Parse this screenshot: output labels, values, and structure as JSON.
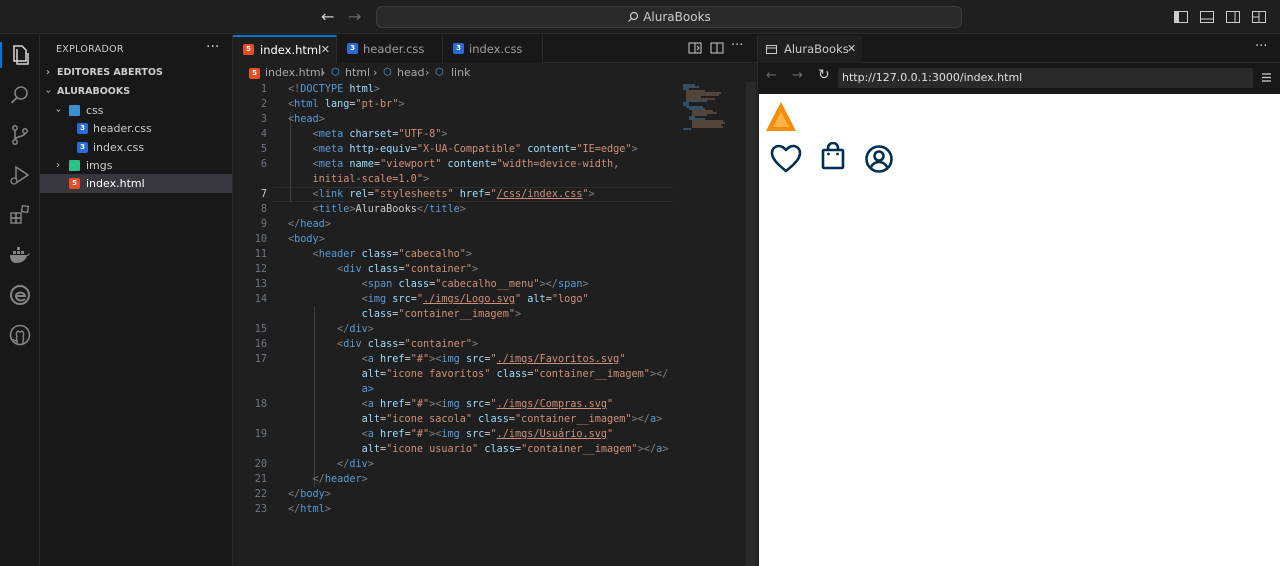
{
  "titlebar": {
    "back_icon": "arrow-left-icon",
    "forward_icon": "arrow-right-icon",
    "search_text": "AluraBooks"
  },
  "activity_bar": [
    "explorer-icon",
    "search-icon",
    "source-control-icon",
    "run-debug-icon",
    "extensions-icon",
    "docker-icon",
    "edge-icon",
    "github-icon"
  ],
  "sidebar": {
    "title": "EXPLORADOR",
    "more": "···",
    "sections": {
      "open_editors": "EDITORES ABERTOS",
      "project": "ALURABOOKS"
    },
    "tree": {
      "css_folder": "css",
      "header_css": "header.css",
      "index_css": "index.css",
      "imgs_folder": "imgs",
      "index_html": "index.html"
    }
  },
  "editor": {
    "tabs": {
      "t1": "index.html",
      "t2": "header.css",
      "t3": "index.css"
    },
    "close": "✕",
    "breadcrumb": {
      "file": "index.html",
      "c1": "html",
      "c2": "head",
      "c3": "link"
    },
    "lines": [
      {
        "n": "1"
      },
      {
        "n": "2"
      },
      {
        "n": "3"
      },
      {
        "n": "4"
      },
      {
        "n": "5"
      },
      {
        "n": "6"
      },
      {
        "n": "7"
      },
      {
        "n": "8"
      },
      {
        "n": "9"
      },
      {
        "n": "10"
      },
      {
        "n": "11"
      },
      {
        "n": "12"
      },
      {
        "n": "13"
      },
      {
        "n": "14"
      },
      {
        "n": "15"
      },
      {
        "n": "16"
      },
      {
        "n": "17"
      },
      {
        "n": "18"
      },
      {
        "n": "19"
      },
      {
        "n": "20"
      },
      {
        "n": "21"
      },
      {
        "n": "22"
      },
      {
        "n": "23"
      }
    ],
    "code": {
      "doctype": "DOCTYPE",
      "html": "html",
      "lang": "lang",
      "pt_br": "\"pt-br\"",
      "head": "head",
      "meta": "meta",
      "charset": "charset",
      "utf8": "\"UTF-8\"",
      "http_equiv": "http-equiv",
      "x_ua": "\"X-UA-Compatible\"",
      "content": "content",
      "ie_edge": "\"IE=edge\"",
      "name": "name",
      "viewport": "\"viewport\"",
      "vp_content1": "\"width=device-width,",
      "vp_content2": "initial-scale=1.0\"",
      "link": "link",
      "rel": "rel",
      "stylesheets": "\"stylesheets\"",
      "href": "href",
      "css_path": "/css/index.css",
      "title": "title",
      "title_text": "AluraBooks",
      "body": "body",
      "header": "header",
      "class": "class",
      "cabecalho": "\"cabecalho\"",
      "div": "div",
      "container": "\"container\"",
      "span": "span",
      "cabecalho_menu": "\"cabecalho__menu\"",
      "img": "img",
      "src": "src",
      "logo_path": "./imgs/Logo.svg",
      "alt": "alt",
      "logo_alt": "\"logo\"",
      "container_imagem": "\"container__imagem\"",
      "a": "a",
      "hash": "\"#\"",
      "fav_path": "./imgs/Favoritos.svg",
      "fav_alt": "\"icone favoritos\"",
      "comp_path": "./imgs/Compras.svg",
      "comp_alt": "\"icone sacola\"",
      "user_path": "./imgs/Usuário.svg",
      "user_alt": "\"icone usuario\"",
      "a_close_frag": "</",
      "a_close_end": "a>"
    }
  },
  "preview": {
    "tab": "AluraBooks",
    "url": "http://127.0.0.1:3000/index.html",
    "colors": {
      "logo": "#f48c06",
      "icons": "#002f52"
    }
  }
}
